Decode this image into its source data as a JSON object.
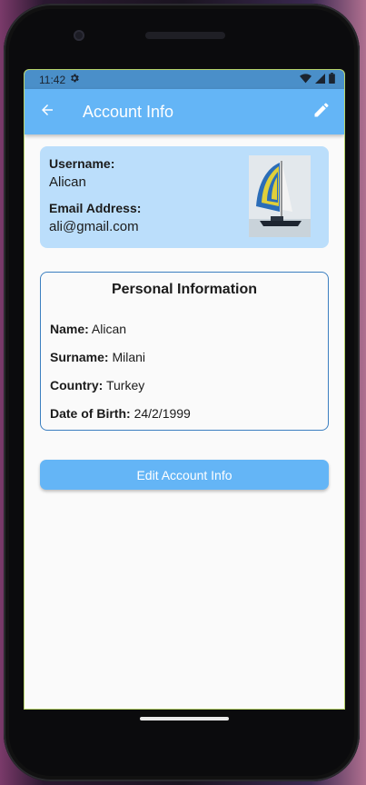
{
  "status": {
    "time": "11:42"
  },
  "appbar": {
    "title": "Account Info"
  },
  "account": {
    "username_label": "Username:",
    "username": "Alican",
    "email_label": "Email Address:",
    "email": "ali@gmail.com"
  },
  "personal": {
    "title": "Personal Information",
    "rows": [
      {
        "label": "Name:",
        "value": "Alican"
      },
      {
        "label": "Surname:",
        "value": "Milani"
      },
      {
        "label": "Country:",
        "value": "Turkey"
      },
      {
        "label": "Date of Birth:",
        "value": "24/2/1999"
      }
    ]
  },
  "actions": {
    "edit_account_label": "Edit Account Info"
  },
  "icons": {
    "back": "arrow-back-icon",
    "edit": "pencil-icon",
    "settings": "gear-icon",
    "wifi": "wifi-icon",
    "signal": "cell-signal-icon",
    "battery": "battery-icon"
  },
  "colors": {
    "appbar": "#64b5f6",
    "card": "#bbdefb",
    "border": "#3b7fc0"
  }
}
